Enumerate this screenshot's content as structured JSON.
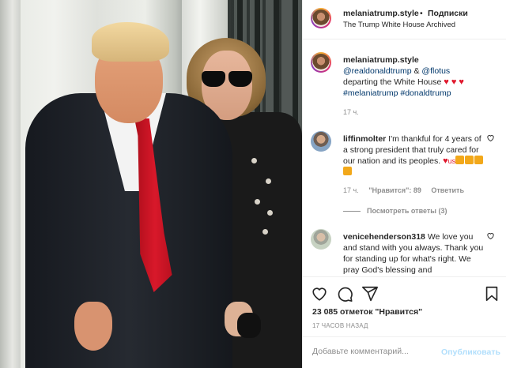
{
  "post": {
    "username": "melaniatrump.style",
    "separator": "•",
    "follow_label": "Подписки",
    "location": "The Trump White House Archived"
  },
  "caption": {
    "username": "melaniatrump.style",
    "mention1": "@realdonaldtrump",
    "amp": "&",
    "mention2": "@flotus",
    "text": "departing the White House",
    "hearts": "♥ ♥ ♥",
    "hashtags": "#melaniatrump #donaldtrump",
    "time": "17 ч."
  },
  "comments": [
    {
      "username": "liffinmolter",
      "text": "I'm thankful for 4 years of a strong president that truly cared for our nation and its peoples.",
      "suffix": "us",
      "time": "17 ч.",
      "likes": "\"Нравится\": 89",
      "reply_label": "Ответить"
    },
    {
      "username": "venicehenderson318",
      "text": "We love you and stand with you always. Thank you for standing up for what's right. We pray God's blessing and"
    }
  ],
  "replies_toggle": "Посмотреть ответы (3)",
  "likes_count": "23 085 отметок \"Нравится\"",
  "posted_ago": "17 ЧАСОВ НАЗАД",
  "composer": {
    "placeholder": "Добавьте комментарий...",
    "publish_label": "Опубликовать"
  },
  "colors": {
    "link_blue": "#00376b",
    "heart_red": "#e0182d",
    "publish_disabled": "#b2dffc"
  },
  "icons": [
    "heart-icon",
    "comment-icon",
    "share-icon",
    "bookmark-icon"
  ]
}
